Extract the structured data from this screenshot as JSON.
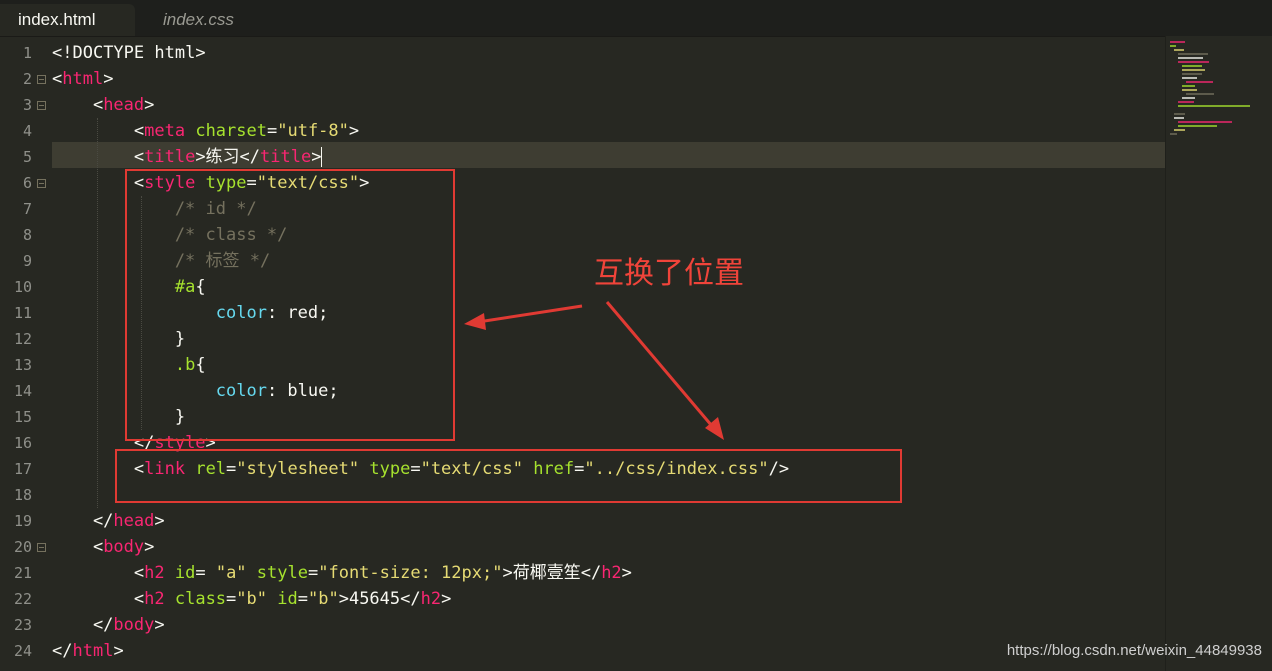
{
  "tabs": [
    {
      "label": "index.html",
      "active": true
    },
    {
      "label": "index.css",
      "active": false
    }
  ],
  "annotation": {
    "text": "互换了位置",
    "color": "#e03a33"
  },
  "watermark": "https://blog.csdn.net/weixin_44849938",
  "code": {
    "lines": [
      {
        "n": "1",
        "tokens": [
          [
            "c-tag-bracket",
            "<!"
          ],
          [
            "c-w",
            "DOCTYPE html"
          ],
          [
            "c-tag-bracket",
            ">"
          ]
        ]
      },
      {
        "n": "2",
        "tokens": [
          [
            "c-w",
            "<"
          ],
          [
            "c-tag",
            "html"
          ],
          [
            "c-w",
            ">"
          ]
        ]
      },
      {
        "n": "3",
        "tokens": [
          [
            "c-w",
            "    <"
          ],
          [
            "c-tag",
            "head"
          ],
          [
            "c-w",
            ">"
          ]
        ]
      },
      {
        "n": "4",
        "tokens": [
          [
            "c-w",
            "        <"
          ],
          [
            "c-tag",
            "meta"
          ],
          [
            "c-w",
            " "
          ],
          [
            "c-attr",
            "charset"
          ],
          [
            "c-w",
            "="
          ],
          [
            "c-str",
            "\"utf-8\""
          ],
          [
            "c-w",
            ">"
          ]
        ]
      },
      {
        "n": "5",
        "tokens": [
          [
            "c-w",
            "        <"
          ],
          [
            "c-tag",
            "title"
          ],
          [
            "c-w",
            ">练习</"
          ],
          [
            "c-tag",
            "title"
          ],
          [
            "c-w",
            ">"
          ]
        ]
      },
      {
        "n": "6",
        "tokens": [
          [
            "c-w",
            "        <"
          ],
          [
            "c-tag",
            "style"
          ],
          [
            "c-w",
            " "
          ],
          [
            "c-attr",
            "type"
          ],
          [
            "c-w",
            "="
          ],
          [
            "c-str",
            "\"text/css\""
          ],
          [
            "c-w",
            ">"
          ]
        ]
      },
      {
        "n": "7",
        "tokens": [
          [
            "c-com",
            "            /* id */"
          ]
        ]
      },
      {
        "n": "8",
        "tokens": [
          [
            "c-com",
            "            /* class */"
          ]
        ]
      },
      {
        "n": "9",
        "tokens": [
          [
            "c-com",
            "            /* 标签 */"
          ]
        ]
      },
      {
        "n": "10",
        "tokens": [
          [
            "c-w",
            "            "
          ],
          [
            "c-attr",
            "#a"
          ],
          [
            "c-w",
            "{"
          ]
        ]
      },
      {
        "n": "11",
        "tokens": [
          [
            "c-w",
            "                "
          ],
          [
            "c-prop",
            "color"
          ],
          [
            "c-w",
            ": red;"
          ]
        ]
      },
      {
        "n": "12",
        "tokens": [
          [
            "c-w",
            "            }"
          ]
        ]
      },
      {
        "n": "13",
        "tokens": [
          [
            "c-w",
            "            "
          ],
          [
            "c-attr",
            ".b"
          ],
          [
            "c-w",
            "{"
          ]
        ]
      },
      {
        "n": "14",
        "tokens": [
          [
            "c-w",
            "                "
          ],
          [
            "c-prop",
            "color"
          ],
          [
            "c-w",
            ": blue;"
          ]
        ]
      },
      {
        "n": "15",
        "tokens": [
          [
            "c-w",
            "            }"
          ]
        ]
      },
      {
        "n": "16",
        "tokens": [
          [
            "c-w",
            "        </"
          ],
          [
            "c-tag",
            "style"
          ],
          [
            "c-w",
            ">"
          ]
        ]
      },
      {
        "n": "17",
        "tokens": [
          [
            "c-w",
            "        <"
          ],
          [
            "c-tag",
            "link"
          ],
          [
            "c-w",
            " "
          ],
          [
            "c-attr",
            "rel"
          ],
          [
            "c-w",
            "="
          ],
          [
            "c-str",
            "\"stylesheet\""
          ],
          [
            "c-w",
            " "
          ],
          [
            "c-attr",
            "type"
          ],
          [
            "c-w",
            "="
          ],
          [
            "c-str",
            "\"text/css\""
          ],
          [
            "c-w",
            " "
          ],
          [
            "c-attr",
            "href"
          ],
          [
            "c-w",
            "="
          ],
          [
            "c-str",
            "\"../css/index.css\""
          ],
          [
            "c-w",
            "/>"
          ]
        ]
      },
      {
        "n": "18",
        "tokens": []
      },
      {
        "n": "19",
        "tokens": [
          [
            "c-w",
            "    </"
          ],
          [
            "c-tag",
            "head"
          ],
          [
            "c-w",
            ">"
          ]
        ]
      },
      {
        "n": "20",
        "tokens": [
          [
            "c-w",
            "    <"
          ],
          [
            "c-tag",
            "body"
          ],
          [
            "c-w",
            ">"
          ]
        ]
      },
      {
        "n": "21",
        "tokens": [
          [
            "c-w",
            "        <"
          ],
          [
            "c-tag",
            "h2"
          ],
          [
            "c-w",
            " "
          ],
          [
            "c-attr",
            "id"
          ],
          [
            "c-w",
            "= "
          ],
          [
            "c-str",
            "\"a\""
          ],
          [
            "c-w",
            " "
          ],
          [
            "c-attr",
            "style"
          ],
          [
            "c-w",
            "="
          ],
          [
            "c-str",
            "\"font-size: 12px;\""
          ],
          [
            "c-w",
            ">荷椰壹笙</"
          ],
          [
            "c-tag",
            "h2"
          ],
          [
            "c-w",
            ">"
          ]
        ]
      },
      {
        "n": "22",
        "tokens": [
          [
            "c-w",
            "        <"
          ],
          [
            "c-tag",
            "h2"
          ],
          [
            "c-w",
            " "
          ],
          [
            "c-attr",
            "class"
          ],
          [
            "c-w",
            "="
          ],
          [
            "c-str",
            "\"b\""
          ],
          [
            "c-w",
            " "
          ],
          [
            "c-attr",
            "id"
          ],
          [
            "c-w",
            "="
          ],
          [
            "c-str",
            "\"b\""
          ],
          [
            "c-w",
            ">45645</"
          ],
          [
            "c-tag",
            "h2"
          ],
          [
            "c-w",
            ">"
          ]
        ]
      },
      {
        "n": "23",
        "tokens": [
          [
            "c-w",
            "    </"
          ],
          [
            "c-tag",
            "body"
          ],
          [
            "c-w",
            ">"
          ]
        ]
      },
      {
        "n": "24",
        "tokens": [
          [
            "c-w",
            "</"
          ],
          [
            "c-tag",
            "html"
          ],
          [
            "c-w",
            ">"
          ]
        ]
      }
    ]
  }
}
